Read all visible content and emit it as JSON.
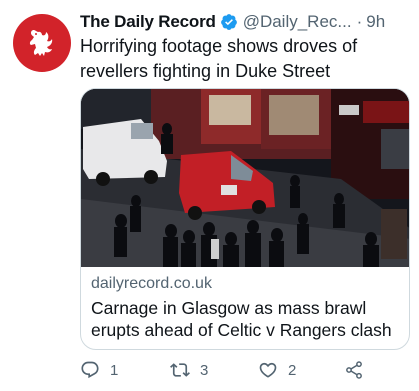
{
  "tweet": {
    "display_name": "The Daily Record",
    "handle": "@Daily_Rec...",
    "separator": "·",
    "time": "9h",
    "text": "Horrifying footage shows droves of revellers fighting in Duke Street",
    "verified": true,
    "avatar_icon": "lion-rampant-icon",
    "avatar_color": "#d2232a"
  },
  "card": {
    "domain": "dailyrecord.co.uk",
    "title": "Carnage in Glasgow as mass brawl erupts ahead of Celtic v Rangers clash",
    "image_description_icon": "street-scene-image"
  },
  "actions": {
    "replies": "1",
    "retweets": "3",
    "likes": "2"
  },
  "colors": {
    "text": "#0f1419",
    "muted": "#536471",
    "verified": "#1d9bf0",
    "border": "#cfd9de"
  }
}
